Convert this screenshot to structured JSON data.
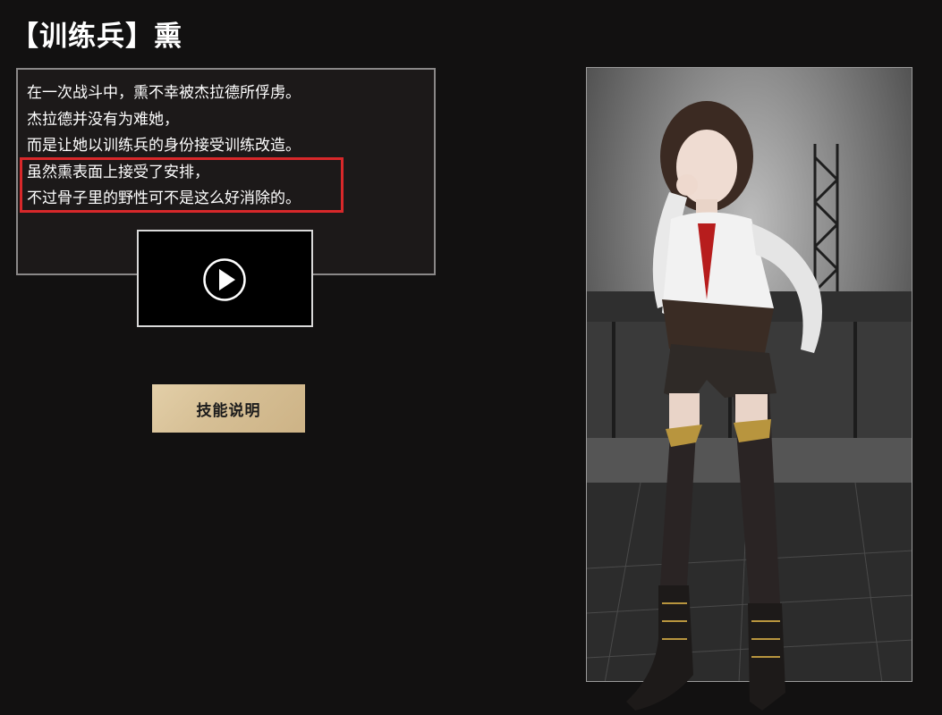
{
  "header": {
    "title": "【训练兵】熏"
  },
  "description": {
    "lines": [
      "在一次战斗中，熏不幸被杰拉德所俘虏。",
      "杰拉德并没有为难她，",
      "而是让她以训练兵的身份接受训练改造。",
      "虽然熏表面上接受了安排，",
      "不过骨子里的野性可不是这么好消除的。"
    ]
  },
  "video": {
    "icon": "play-icon"
  },
  "skill_button": {
    "label": "技能说明"
  },
  "colors": {
    "background": "#121111",
    "highlight_border": "#d8282a",
    "button_bg": "#d6bf95"
  }
}
